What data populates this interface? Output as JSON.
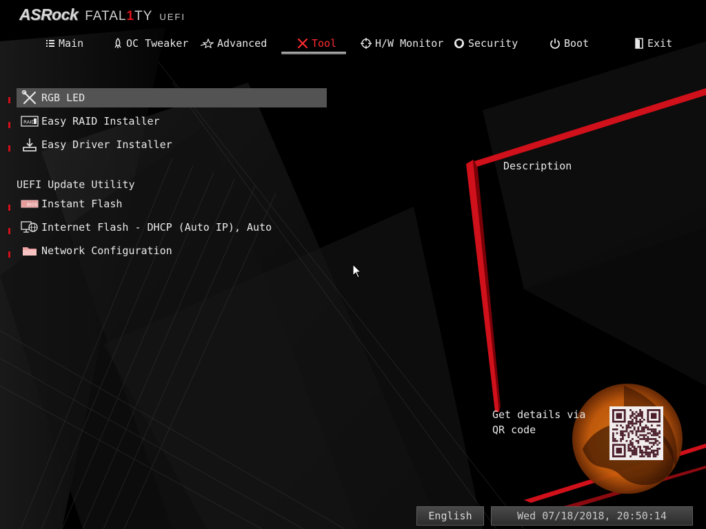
{
  "brand": {
    "name": "ASRock",
    "series_a": "FATAL",
    "series_b": "1",
    "series_c": "TY",
    "suffix": "UEFI"
  },
  "tabs": [
    {
      "label": "Main",
      "icon": "list-icon"
    },
    {
      "label": "OC Tweaker",
      "icon": "rocket-icon"
    },
    {
      "label": "Advanced",
      "icon": "star-icon"
    },
    {
      "label": "Tool",
      "icon": "tools-icon",
      "active": true
    },
    {
      "label": "H/W Monitor",
      "icon": "crosshair-icon"
    },
    {
      "label": "Security",
      "icon": "shield-icon"
    },
    {
      "label": "Boot",
      "icon": "power-icon"
    },
    {
      "label": "Exit",
      "icon": "exit-door-icon"
    }
  ],
  "menu": {
    "items": [
      {
        "label": "RGB LED",
        "icon": "wrench-screwdriver-icon",
        "selected": true
      },
      {
        "label": "Easy RAID Installer",
        "icon": "raid-icon",
        "icon_text": "RAID"
      },
      {
        "label": "Easy Driver Installer",
        "icon": "download-icon"
      }
    ],
    "section_label": "UEFI Update Utility",
    "update_items": [
      {
        "label": "Instant Flash",
        "icon": "bios-chip-icon",
        "icon_text": "BIOS"
      },
      {
        "label": "Internet Flash - DHCP (Auto IP), Auto",
        "icon": "globe-monitor-icon"
      },
      {
        "label": "Network Configuration",
        "icon": "folder-icon"
      }
    ]
  },
  "description": {
    "title": "Description"
  },
  "qr": {
    "text": "Get details via QR code"
  },
  "footer": {
    "language": "English",
    "datetime": "Wed 07/18/2018, 20:50:14"
  },
  "colors": {
    "accent": "#e0141e",
    "selected_bg": "#535353",
    "background": "#000000"
  }
}
